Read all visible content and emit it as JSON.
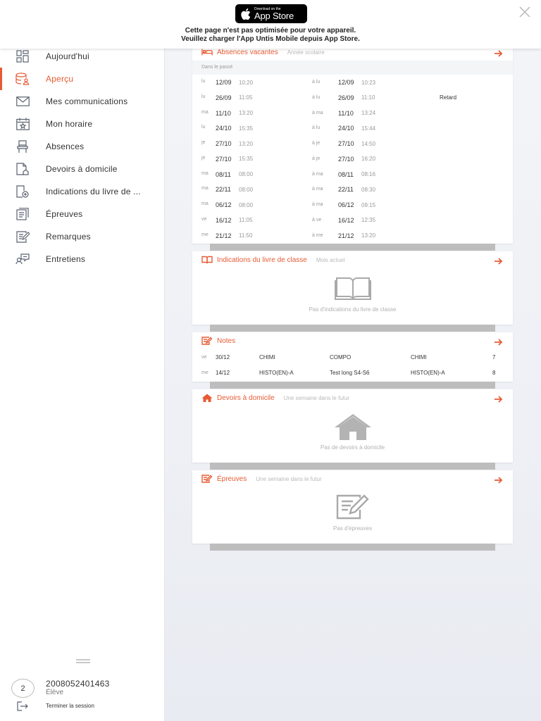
{
  "banner": {
    "appstore_small": "Download on the",
    "appstore_big": "App Store",
    "line1": "Cette page n'est pas optimisée pour votre appareil.",
    "line2": "Veuillez charger l'App Untis Mobile depuis App Store."
  },
  "sidebar": {
    "items": [
      {
        "label": "Aujourd'hui",
        "icon": "dashboard-icon"
      },
      {
        "label": "Aperçu",
        "icon": "profile-icon",
        "active": true
      },
      {
        "label": "Mes communications",
        "icon": "mail-icon"
      },
      {
        "label": "Mon horaire",
        "icon": "calendar-icon"
      },
      {
        "label": "Absences",
        "icon": "chair-icon"
      },
      {
        "label": "Devoirs à domicile",
        "icon": "homework-icon"
      },
      {
        "label": "Indications du livre de ...",
        "icon": "book-plus-icon"
      },
      {
        "label": "Épreuves",
        "icon": "exams-icon"
      },
      {
        "label": "Remarques",
        "icon": "remarks-icon"
      },
      {
        "label": "Entretiens",
        "icon": "conversation-icon"
      }
    ],
    "user": {
      "avatar": "2",
      "id": "2008052401463",
      "role": "Élève",
      "logout": "Terminer la session"
    }
  },
  "accent": "#e75b34",
  "absences": {
    "title": "Absences vacantes",
    "subtitle": "Année scolaire",
    "section": "Dans le passé",
    "rows": [
      {
        "day1": "lu",
        "date1": "12/09",
        "time1": "10:20",
        "sep": "à lu",
        "date2": "12/09",
        "time2": "10:23",
        "remark": ""
      },
      {
        "day1": "lu",
        "date1": "26/09",
        "time1": "11:05",
        "sep": "à lu",
        "date2": "26/09",
        "time2": "11:10",
        "remark": "Retard"
      },
      {
        "day1": "ma",
        "date1": "11/10",
        "time1": "13:20",
        "sep": "à ma",
        "date2": "11/10",
        "time2": "13:24",
        "remark": ""
      },
      {
        "day1": "lu",
        "date1": "24/10",
        "time1": "15:35",
        "sep": "à lu",
        "date2": "24/10",
        "time2": "15:44",
        "remark": ""
      },
      {
        "day1": "je",
        "date1": "27/10",
        "time1": "13:20",
        "sep": "à je",
        "date2": "27/10",
        "time2": "14:50",
        "remark": ""
      },
      {
        "day1": "je",
        "date1": "27/10",
        "time1": "15:35",
        "sep": "à je",
        "date2": "27/10",
        "time2": "16:20",
        "remark": ""
      },
      {
        "day1": "ma",
        "date1": "08/11",
        "time1": "08:00",
        "sep": "à ma",
        "date2": "08/11",
        "time2": "08:16",
        "remark": ""
      },
      {
        "day1": "ma",
        "date1": "22/11",
        "time1": "08:00",
        "sep": "à ma",
        "date2": "22/11",
        "time2": "08:30",
        "remark": ""
      },
      {
        "day1": "ma",
        "date1": "06/12",
        "time1": "08:00",
        "sep": "à ma",
        "date2": "06/12",
        "time2": "09:15",
        "remark": ""
      },
      {
        "day1": "ve",
        "date1": "16/12",
        "time1": "11:05",
        "sep": "à ve",
        "date2": "16/12",
        "time2": "12:35",
        "remark": ""
      },
      {
        "day1": "me",
        "date1": "21/12",
        "time1": "11:50",
        "sep": "à me",
        "date2": "21/12",
        "time2": "13:20",
        "remark": ""
      }
    ]
  },
  "classbook": {
    "title": "Indications du livre de classe",
    "subtitle": "Mois actuel",
    "empty": "Pas d'indications du livre de classe"
  },
  "notes": {
    "title": "Notes",
    "rows": [
      {
        "day": "ve",
        "date": "30/12",
        "subject": "CHIMI",
        "type": "COMPO",
        "subject2": "CHIMI",
        "grade": "7"
      },
      {
        "day": "me",
        "date": "14/12",
        "subject": "HISTO(EN)-A",
        "type": "Test long S4-S6",
        "subject2": "HISTO(EN)-A",
        "grade": "8"
      }
    ]
  },
  "homework": {
    "title": "Devoirs à domicile",
    "subtitle": "Une semaine dans le futur",
    "empty": "Pas de devoirs à domicile"
  },
  "exams": {
    "title": "Épreuves",
    "subtitle": "Une semaine dans le futur",
    "empty": "Pas d'épreuves"
  }
}
